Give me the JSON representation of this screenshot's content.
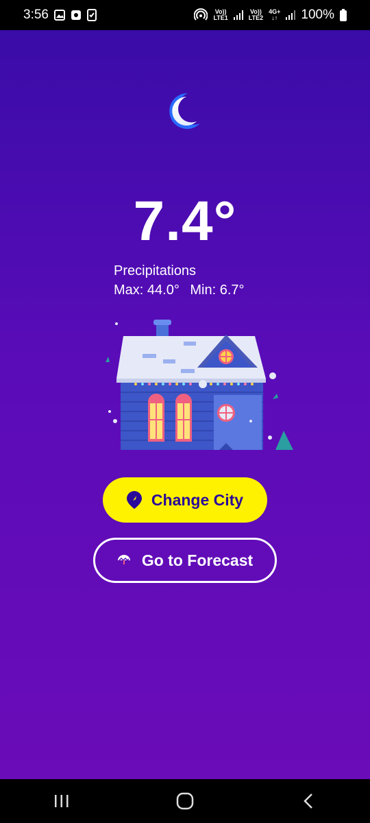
{
  "status_bar": {
    "time": "3:56",
    "sim1_top": "Vo))",
    "sim1_bottom": "LTE1",
    "sim2_top": "Vo))",
    "sim2_bottom": "LTE2",
    "network_type": "4G+",
    "battery": "100%",
    "icons": [
      "gallery-icon",
      "app-notification-icon",
      "checklist-icon",
      "hotspot-icon",
      "signal-icon",
      "battery-icon"
    ]
  },
  "weather": {
    "condition_icon": "crescent-moon-icon",
    "temperature": "7.4°",
    "description": "Precipitations",
    "max": "Max: 44.0°",
    "min": "Min: 6.7°",
    "illustration": "winter-house-illustration"
  },
  "actions": {
    "change_city_label": "Change City",
    "change_city_icon": "location-pin-icon",
    "forecast_label": "Go to Forecast",
    "forecast_icon": "umbrella-icon"
  },
  "colors": {
    "gradient_top": "#3a0ca8",
    "gradient_bottom": "#6a0cb8",
    "accent_yellow": "#fff200",
    "button_text": "#2a0a9a"
  },
  "nav_bar": {
    "icons": [
      "recent-apps-icon",
      "home-icon",
      "back-icon"
    ]
  }
}
